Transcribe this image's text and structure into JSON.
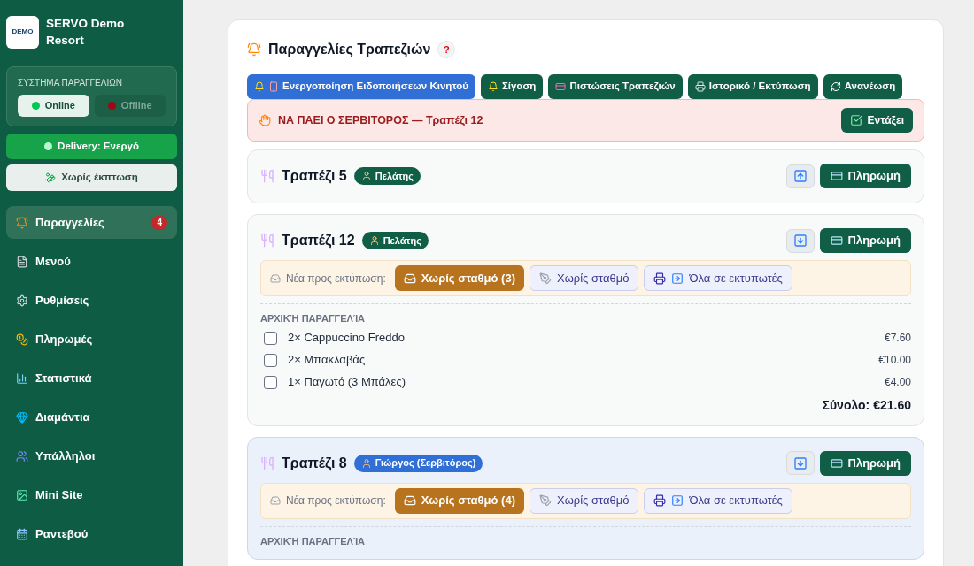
{
  "sidebar": {
    "brand": {
      "logo": "DEMO",
      "title": "SERVO Demo Resort"
    },
    "order_system": {
      "label": "ΣΥΣΤΗΜΑ ΠΑΡΑΓΓΕΛΙΩΝ",
      "options": [
        {
          "label": "Online",
          "selected": true
        },
        {
          "label": "Offline",
          "selected": false
        }
      ]
    },
    "delivery": {
      "label": "Delivery: Ενεργό",
      "on": true
    },
    "discount": {
      "label": "Χωρίς έκπτωση"
    },
    "items": [
      {
        "label": "Παραγγελίες",
        "selected": true,
        "badge": "4"
      },
      {
        "label": "Μενού",
        "selected": false
      },
      {
        "label": "Ρυθμίσεις",
        "selected": false
      },
      {
        "label": "Πληρωμές",
        "selected": false
      },
      {
        "label": "Στατιστικά",
        "selected": false
      },
      {
        "label": "Διαμάντια",
        "selected": false
      },
      {
        "label": "Υπάλληλοι",
        "selected": false
      },
      {
        "label": "Mini Site",
        "selected": false
      },
      {
        "label": "Ραντεβού",
        "selected": false
      }
    ]
  },
  "main": {
    "title": "Παραγγελίες Τραπεζιών",
    "help": "?",
    "toolbar": [
      {
        "label": "Ενεργοποίηση Ειδοποιήσεων Κινητού",
        "color": "#2f6fd6"
      },
      {
        "label": "Σίγαση",
        "color": "#0f5e45"
      },
      {
        "label": "Πιστώσεις Τραπεζιών",
        "color": "#0f5e45"
      },
      {
        "label": "Ιστορικό / Εκτύπωση",
        "color": "#0f5e45"
      },
      {
        "label": "Ανανέωση",
        "color": "#0f5e45"
      }
    ],
    "alert": {
      "text": "ΝΑ ΠΑΕΙ Ο ΣΕΡΒΙΤΟΡΟΣ — Τραπέζι 12",
      "button": "Εντάξει"
    },
    "tables": [
      {
        "name": "Τραπέζι 5",
        "badge": {
          "label": "Πελάτης",
          "color": "#0f5e45"
        },
        "expanded": false,
        "highlighted": false,
        "pay": "Πληρωμή"
      },
      {
        "name": "Τραπέζι 12",
        "badge": {
          "label": "Πελάτης",
          "color": "#0f5e45"
        },
        "expanded": true,
        "highlighted": false,
        "pay": "Πληρωμή",
        "print": {
          "label": "Νέα προς εκτύπωση:",
          "buttons": [
            {
              "kind": "primary",
              "label": "Χωρίς σταθμό (3)"
            },
            {
              "kind": "station",
              "label": "Χωρίς σταθμό"
            },
            {
              "kind": "all",
              "label": "Όλα σε εκτυπωτές"
            }
          ]
        },
        "section": "ΑΡΧΙΚΉ ΠΑΡΑΓΓΕΛΊΑ",
        "items": [
          {
            "label": "2× Cappuccino Freddo",
            "price": "€7.60",
            "checked": false
          },
          {
            "label": "2× Μπακλαβάς",
            "price": "€10.00",
            "checked": false
          },
          {
            "label": "1× Παγωτό (3 Μπάλες)",
            "price": "€4.00",
            "checked": false
          }
        ],
        "total": "Σύνολο: €21.60"
      },
      {
        "name": "Τραπέζι 8",
        "badge": {
          "label": "Γιώργος (Σερβιτόρος)",
          "color": "#2f6fd6"
        },
        "expanded": true,
        "highlighted": true,
        "pay": "Πληρωμή",
        "print": {
          "label": "Νέα προς εκτύπωση:",
          "buttons": [
            {
              "kind": "primary",
              "label": "Χωρίς σταθμό (4)"
            },
            {
              "kind": "station",
              "label": "Χωρίς σταθμό"
            },
            {
              "kind": "all",
              "label": "Όλα σε εκτυπωτές"
            }
          ]
        },
        "section": "ΑΡΧΙΚΉ ΠΑΡΑΓΓΕΛΊΑ"
      }
    ]
  }
}
